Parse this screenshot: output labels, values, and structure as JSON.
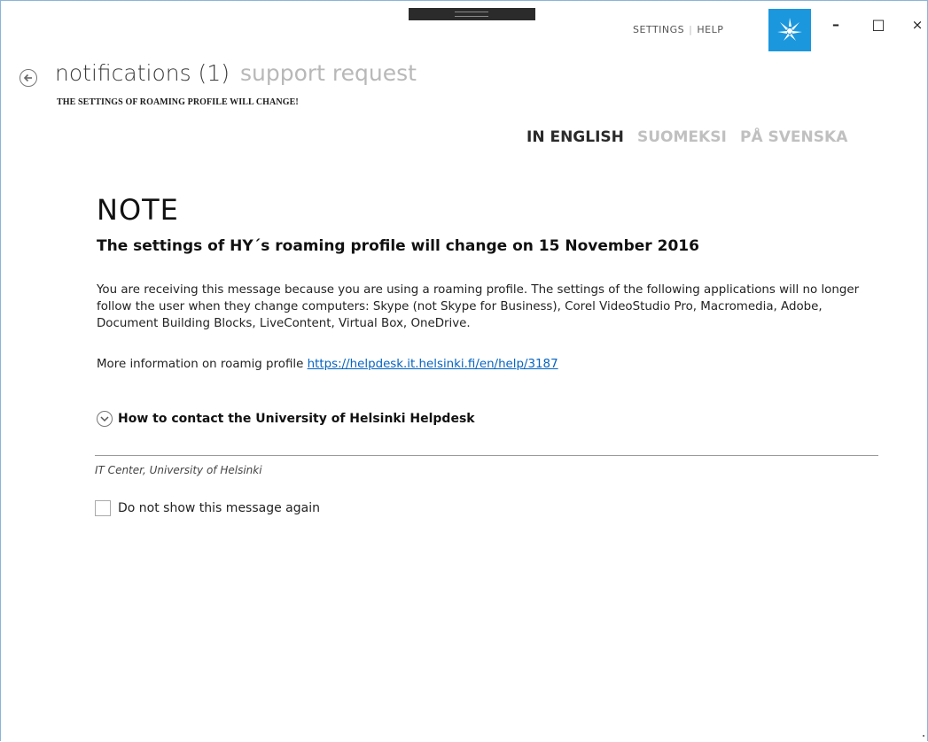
{
  "window": {
    "menu": {
      "settings_label": "SETTINGS",
      "separator": "|",
      "help_label": "HELP"
    },
    "controls": {
      "minimize": "–",
      "maximize": "□",
      "close": "×"
    },
    "logo_bg_color": "#1b97de"
  },
  "header": {
    "tabs": [
      {
        "label": "notifications (1)",
        "active": true
      },
      {
        "label": "support request",
        "active": false
      }
    ],
    "subtitle": "THE SETTINGS OF ROAMING PROFILE WILL CHANGE!"
  },
  "languages": [
    {
      "label": "IN ENGLISH",
      "active": true
    },
    {
      "label": "SUOMEKSI",
      "active": false
    },
    {
      "label": "PÅ SVENSKA",
      "active": false
    }
  ],
  "message": {
    "note": "NOTE",
    "headline": "The settings of HY´s roaming profile will change on 15 November 2016",
    "body": "You are receiving this message because you are using a roaming profile. The settings of the following applications will no longer follow the user when they change computers: Skype (not Skype for Business), Corel VideoStudio Pro, Macromedia, Adobe, Document Building Blocks, LiveContent, Virtual Box, OneDrive.",
    "more_info_text": "More information on roamig profile",
    "more_info_link": "https://helpdesk.it.helsinki.fi/en/help/3187",
    "expander_label": "How to contact the University of Helsinki Helpdesk",
    "sender": "IT Center, University of Helsinki"
  },
  "checkbox": {
    "label": "Do not show this message again",
    "checked": false
  },
  "colors": {
    "link": "#0563c1",
    "inactive_text": "#c0c0c0",
    "window_border": "#8ab4d8"
  }
}
